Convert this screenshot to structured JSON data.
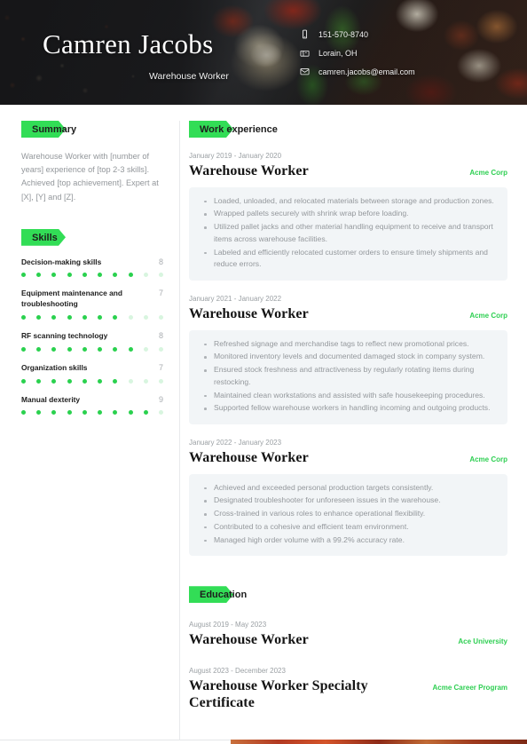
{
  "header": {
    "name": "Camren Jacobs",
    "job_title": "Warehouse Worker",
    "contacts": [
      {
        "icon": "phone-icon",
        "value": "151-570-8740"
      },
      {
        "icon": "location-icon",
        "value": "Lorain, OH"
      },
      {
        "icon": "email-icon",
        "value": "camren.jacobs@email.com"
      }
    ]
  },
  "theme": {
    "accent_green": "#32dd56",
    "org_green": "#2ecf52",
    "card_bg": "#f2f5f7",
    "muted_text": "#94989c"
  },
  "sidebar": {
    "summary": {
      "heading": "Summary",
      "text": "Warehouse Worker with [number of years] experience of [top 2-3 skills]. Achieved [top achievement]. Expert at [X], [Y] and [Z]."
    },
    "skills": {
      "heading": "Skills",
      "max": 10,
      "items": [
        {
          "name": "Decision-making skills",
          "score": 8
        },
        {
          "name": "Equipment maintenance and troubleshooting",
          "score": 7
        },
        {
          "name": "RF scanning technology",
          "score": 8
        },
        {
          "name": "Organization skills",
          "score": 7
        },
        {
          "name": "Manual dexterity",
          "score": 9
        }
      ]
    }
  },
  "main": {
    "work": {
      "heading": "Work experience",
      "entries": [
        {
          "date": "January 2019 - January 2020",
          "title": "Warehouse Worker",
          "org": "Acme Corp",
          "bullets": [
            "Loaded, unloaded, and relocated materials between storage and production zones.",
            "Wrapped pallets securely with shrink wrap before loading.",
            "Utilized pallet jacks and other material handling equipment to receive and transport items across warehouse facilities.",
            "Labeled and efficiently relocated customer orders to ensure timely shipments and reduce errors."
          ]
        },
        {
          "date": "January 2021 - January 2022",
          "title": "Warehouse Worker",
          "org": "Acme Corp",
          "bullets": [
            "Refreshed signage and merchandise tags to reflect new promotional prices.",
            "Monitored inventory levels and documented damaged stock in company system.",
            "Ensured stock freshness and attractiveness by regularly rotating items during restocking.",
            "Maintained clean workstations and assisted with safe housekeeping procedures.",
            "Supported fellow warehouse workers in handling incoming and outgoing products."
          ]
        },
        {
          "date": "January 2022 - January 2023",
          "title": "Warehouse Worker",
          "org": "Acme Corp",
          "bullets": [
            "Achieved and exceeded personal production targets consistently.",
            "Designated troubleshooter for unforeseen issues in the warehouse.",
            "Cross-trained in various roles to enhance operational flexibility.",
            "Contributed to a cohesive and efficient team environment.",
            "Managed high order volume with a 99.2% accuracy rate."
          ]
        }
      ]
    },
    "education": {
      "heading": "Education",
      "entries": [
        {
          "date": "August 2019 - May 2023",
          "title": "Warehouse Worker",
          "org": "Ace University"
        },
        {
          "date": "August 2023 - December 2023",
          "title": "Warehouse Worker Specialty Certificate",
          "org": "Acme Career Program"
        }
      ]
    }
  }
}
